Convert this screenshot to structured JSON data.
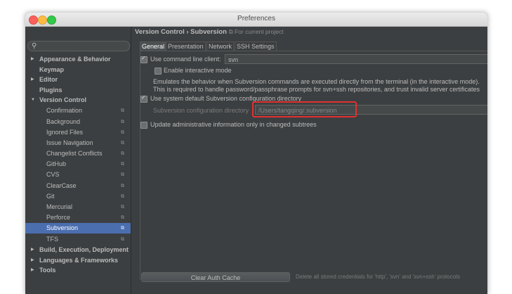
{
  "window": {
    "title": "Preferences"
  },
  "search": {
    "icon": "search-icon"
  },
  "sidebar": {
    "items": [
      {
        "label": "Appearance & Behavior",
        "arrow": "▶"
      },
      {
        "label": "Keymap"
      },
      {
        "label": "Editor",
        "arrow": "▶"
      },
      {
        "label": "Plugins"
      },
      {
        "label": "Version Control",
        "arrow": "▼"
      },
      {
        "label": "Confirmation"
      },
      {
        "label": "Background"
      },
      {
        "label": "Ignored Files"
      },
      {
        "label": "Issue Navigation"
      },
      {
        "label": "Changelist Conflicts"
      },
      {
        "label": "GitHub"
      },
      {
        "label": "CVS"
      },
      {
        "label": "ClearCase"
      },
      {
        "label": "Git"
      },
      {
        "label": "Mercurial"
      },
      {
        "label": "Perforce"
      },
      {
        "label": "Subversion"
      },
      {
        "label": "TFS"
      },
      {
        "label": "Build, Execution, Deployment",
        "arrow": "▶"
      },
      {
        "label": "Languages & Frameworks",
        "arrow": "▶"
      },
      {
        "label": "Tools",
        "arrow": "▶"
      }
    ],
    "project_glyph": "⧉"
  },
  "breadcrumb": {
    "path": "Version Control › Subversion",
    "scope": "⧉ For current project"
  },
  "tabs": [
    "General",
    "Presentation",
    "Network",
    "SSH Settings"
  ],
  "general": {
    "cmd_client_label": "Use command line client:",
    "cmd_client_value": "svn",
    "interactive_label": "Enable interactive mode",
    "desc_line1": "Emulates the behavior when Subversion commands are executed directly from the terminal (in the interactive mode).",
    "desc_line2": "This is required to handle password/passphrase prompts for svn+ssh repositories, and trust invalid server certificates",
    "default_dir_label": "Use system default Subversion configuration directory",
    "config_dir_label": "Subversion configuration directory",
    "config_dir_value": "/Users/tangqing/.subversion",
    "update_label": "Update administrative information only in changed subtrees",
    "clear_cache_button": "Clear Auth Cache",
    "clear_cache_desc": "Delete all stored credentials for 'http', 'svn' and 'svn+ssh' protocols"
  },
  "colors": {
    "selection": "#4b6eaf",
    "highlight": "#e2312f",
    "background": "#3c3f41"
  }
}
